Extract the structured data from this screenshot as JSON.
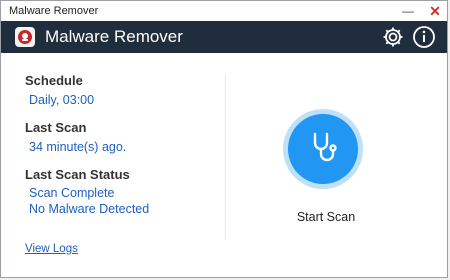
{
  "window": {
    "title": "Malware Remover",
    "minimize_glyph": "—",
    "close_glyph": "✕"
  },
  "app": {
    "title": "Malware Remover",
    "logo_icon": "shield-bug-icon",
    "accent": "#2196f3",
    "header_bg": "#1f2d3d"
  },
  "header": {
    "settings_icon": "gear-icon",
    "info_icon": "info-icon"
  },
  "schedule": {
    "label": "Schedule",
    "value": "Daily, 03:00"
  },
  "last_scan": {
    "label": "Last Scan",
    "value": "34 minute(s) ago."
  },
  "last_status": {
    "label": "Last Scan Status",
    "line1": "Scan Complete",
    "line2": "No Malware Detected"
  },
  "scan": {
    "icon": "stethoscope-icon",
    "label": "Start Scan"
  },
  "links": {
    "view_logs": "View Logs"
  }
}
